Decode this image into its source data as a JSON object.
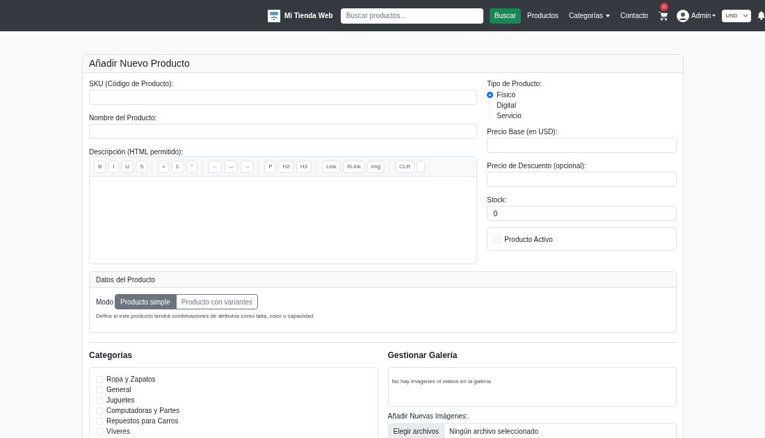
{
  "navbar": {
    "brand": "Mi Tienda Web",
    "search": {
      "placeholder": "Buscar productos..."
    },
    "search_button": "Buscar",
    "links": [
      {
        "label": "Productos",
        "dropdown": false
      },
      {
        "label": "Categorías",
        "dropdown": true
      },
      {
        "label": "Contacto",
        "dropdown": false
      }
    ],
    "cart_count": "0",
    "user": "Admin",
    "currency": "USD"
  },
  "form": {
    "title": "Añadir Nuevo Producto",
    "sku_label": "SKU (Código de Producto):",
    "name_label": "Nombre del Producto:",
    "description_label": "Descripción (HTML permitido):",
    "toolbar": [
      [
        {
          "kind": "text",
          "label": "B"
        },
        {
          "kind": "text",
          "label": "I"
        },
        {
          "kind": "text",
          "label": "U"
        },
        {
          "kind": "text",
          "label": "S"
        }
      ],
      [
        {
          "kind": "text",
          "label": "•"
        },
        {
          "kind": "text",
          "label": "1."
        },
        {
          "kind": "text",
          "label": "\""
        }
      ],
      [
        {
          "kind": "text",
          "label": "←"
        },
        {
          "kind": "text",
          "label": "↔"
        },
        {
          "kind": "text",
          "label": "→"
        }
      ],
      [
        {
          "kind": "text",
          "label": "P"
        },
        {
          "kind": "text",
          "label": "H2"
        },
        {
          "kind": "text",
          "label": "H3"
        }
      ],
      [
        {
          "kind": "text",
          "label": "Link"
        },
        {
          "kind": "text",
          "label": "XLink"
        },
        {
          "kind": "text",
          "label": "Img"
        }
      ],
      [
        {
          "kind": "text",
          "label": "CLR"
        },
        {
          "kind": "blank"
        }
      ]
    ],
    "type_label": "Tipo de Producto:",
    "types": [
      {
        "label": "Físico",
        "selected": true
      },
      {
        "label": "Digital",
        "selected": false
      },
      {
        "label": "Servicio",
        "selected": false
      }
    ],
    "base_price_label": "Precio Base (en USD):",
    "discount_label": "Precio de Descuento (opcional):",
    "stock_label": "Stock:",
    "stock_value": "0",
    "active": {
      "label": "Producto Activo",
      "checked": false
    },
    "product_data": {
      "title": "Datos del Producto",
      "mode_label": "Modo",
      "modes": [
        {
          "label": "Producto simple",
          "selected": true
        },
        {
          "label": "Producto con variantes",
          "selected": false
        }
      ],
      "help": "Define si este producto tendrá combinaciones de atributos como talla, color o capacidad."
    },
    "categories": {
      "title": "Categorías",
      "items": [
        {
          "label": "Ropa y Zapatos",
          "checked": false
        },
        {
          "label": "General",
          "checked": false
        },
        {
          "label": "Juguetes",
          "checked": false
        },
        {
          "label": "Computadoras y Partes",
          "checked": false
        },
        {
          "label": "Repuestos para Carros",
          "checked": false
        },
        {
          "label": "Víveres",
          "checked": false
        }
      ]
    },
    "gallery": {
      "title": "Gestionar Galería",
      "empty": "No hay imágenes ni videos en la galería.",
      "add_label": "Añadir Nuevas Imágenes:",
      "file_button": "Elegir archivos",
      "file_status": "Ningún archivo seleccionado"
    }
  }
}
